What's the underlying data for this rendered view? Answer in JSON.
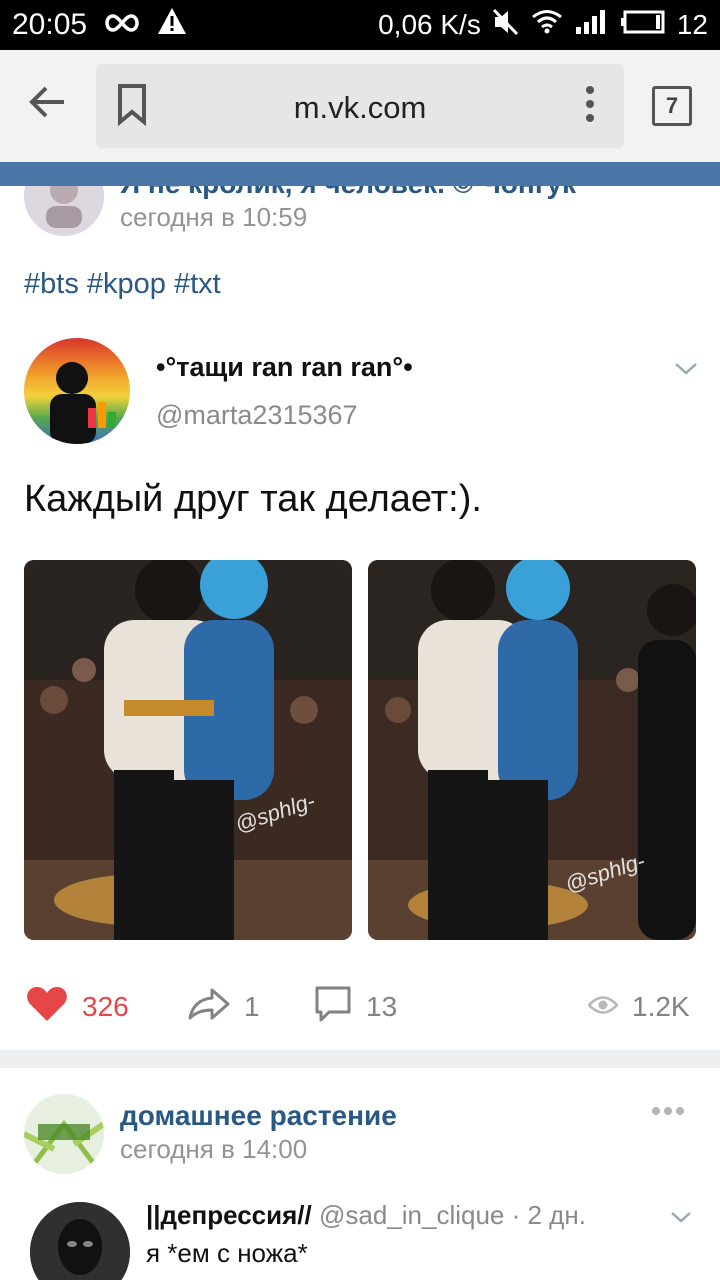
{
  "status_bar": {
    "time": "20:05",
    "speed": "0,06 K/s",
    "battery": "12"
  },
  "browser": {
    "url": "m.vk.com",
    "tab_count": "7"
  },
  "post1": {
    "partial_title": "Я не кролик, я человек. © Чонгук",
    "date": "сегодня в 10:59",
    "hashtags": "#bts #kpop #txt"
  },
  "tweet": {
    "name": "•°тащи ran ran ran°•",
    "handle": "@marta2315367",
    "text": "Каждый друг так делает:).",
    "watermark": "@sphlg-"
  },
  "actions": {
    "likes": "326",
    "shares": "1",
    "comments": "13",
    "views": "1.2K"
  },
  "post2": {
    "name": "домашнее растение",
    "date": "сегодня в 14:00",
    "tweet_name": "||депрессия//",
    "tweet_meta": "@sad_in_clique · 2 дн.",
    "tweet_text": "я *ем с ножа*"
  },
  "colors": {
    "vk_blue": "#4a76a8",
    "link": "#2a5885",
    "like_red": "#e64646"
  }
}
